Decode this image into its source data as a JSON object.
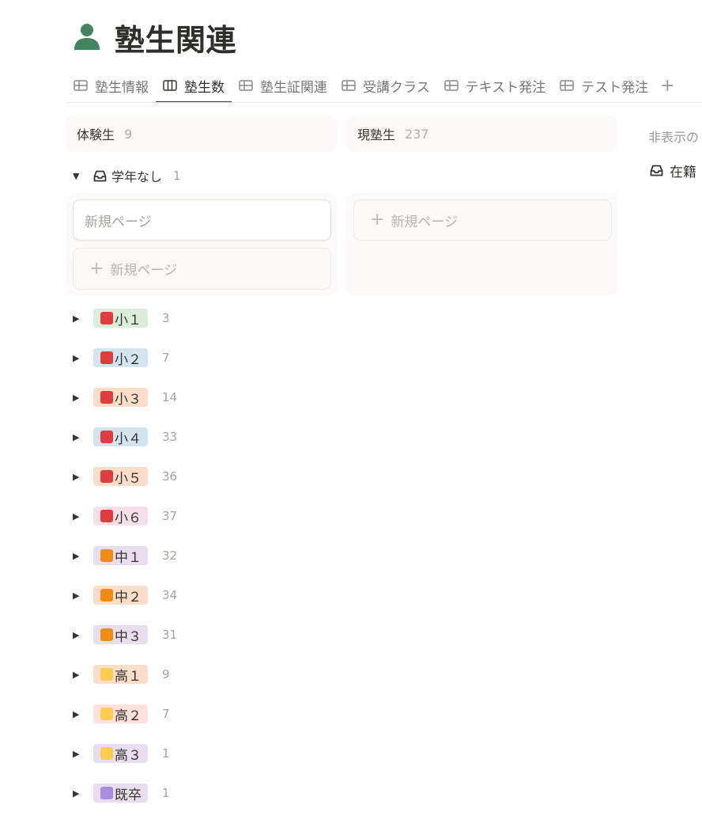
{
  "page": {
    "title": "塾生関連",
    "title_icon": "person-icon",
    "icon_color": "#448361"
  },
  "tabs": [
    {
      "label": "塾生情報",
      "icon": "table-icon",
      "active": false
    },
    {
      "label": "塾生数",
      "icon": "board-icon",
      "active": true
    },
    {
      "label": "塾生証関連",
      "icon": "table-icon",
      "active": false
    },
    {
      "label": "受講クラス",
      "icon": "table-icon",
      "active": false
    },
    {
      "label": "テキスト発注",
      "icon": "table-icon",
      "active": false
    },
    {
      "label": "テスト発注",
      "icon": "table-icon",
      "active": false
    }
  ],
  "tab_add": "+",
  "columns": [
    {
      "name": "体験生",
      "count": "9"
    },
    {
      "name": "現塾生",
      "count": "237"
    }
  ],
  "hidden_columns": {
    "label": "非表示の",
    "item": "在籍"
  },
  "first_group": {
    "label": "学年なし",
    "count": "1",
    "icon": "inbox-icon",
    "expanded": true
  },
  "card": {
    "placeholder": "新規ページ"
  },
  "new_page": {
    "plus": "+",
    "label": "新規ページ"
  },
  "groups": [
    {
      "label": "小１",
      "count": "3",
      "bg": "#dbeddb",
      "square": "#e03e3e"
    },
    {
      "label": "小２",
      "count": "7",
      "bg": "#d3e5ef",
      "square": "#e03e3e"
    },
    {
      "label": "小３",
      "count": "14",
      "bg": "#fadec9",
      "square": "#e03e3e"
    },
    {
      "label": "小４",
      "count": "33",
      "bg": "#d3e5ef",
      "square": "#e03e3e"
    },
    {
      "label": "小５",
      "count": "36",
      "bg": "#fadec9",
      "square": "#e03e3e"
    },
    {
      "label": "小６",
      "count": "37",
      "bg": "#f5e0e9",
      "square": "#e03e3e"
    },
    {
      "label": "中１",
      "count": "32",
      "bg": "#e8deee",
      "square": "#f08c14"
    },
    {
      "label": "中２",
      "count": "34",
      "bg": "#fadec9",
      "square": "#f08c14"
    },
    {
      "label": "中３",
      "count": "31",
      "bg": "#e8deee",
      "square": "#f08c14"
    },
    {
      "label": "高１",
      "count": "9",
      "bg": "#fadec9",
      "square": "#fdcc50"
    },
    {
      "label": "高２",
      "count": "7",
      "bg": "#ffe2dd",
      "square": "#fdcc50"
    },
    {
      "label": "高３",
      "count": "1",
      "bg": "#e8deee",
      "square": "#fdcc50"
    },
    {
      "label": "既卒",
      "count": "1",
      "bg": "#e8deee",
      "square": "#a98ddf"
    }
  ]
}
